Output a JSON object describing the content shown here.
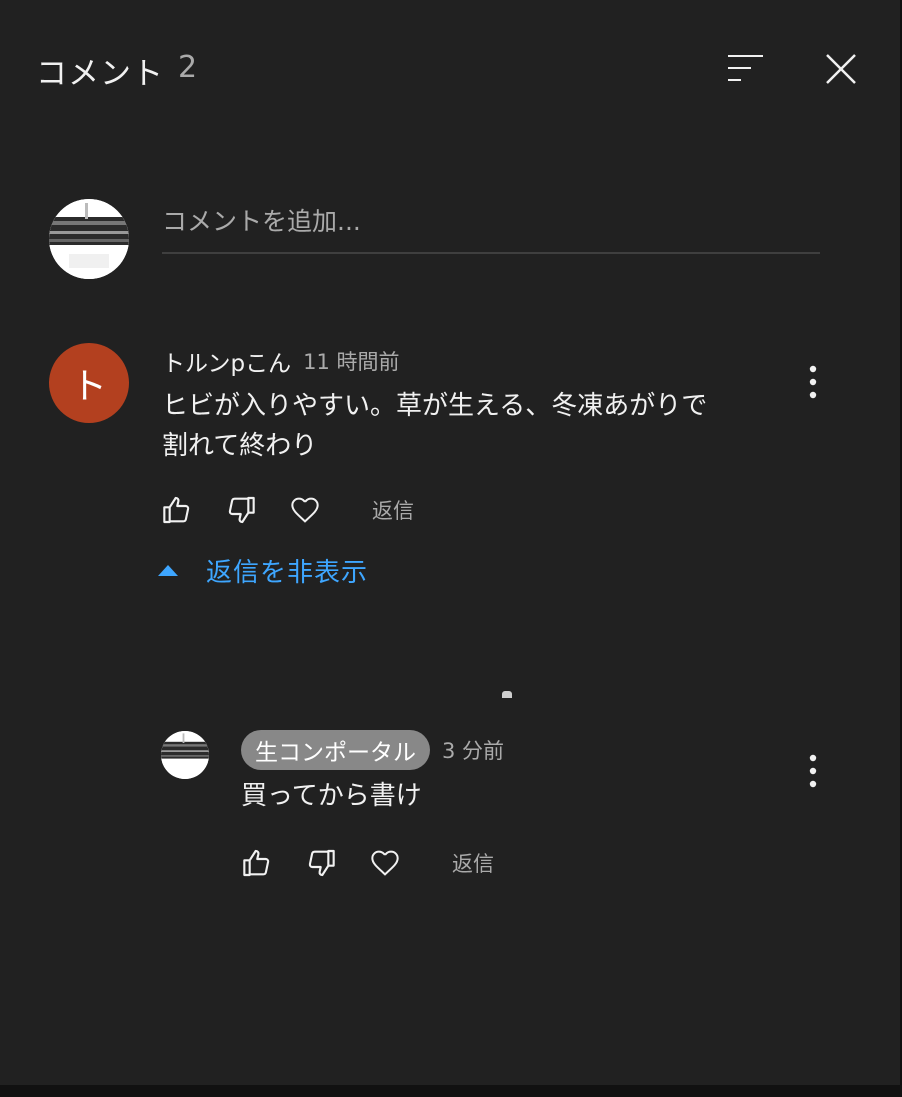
{
  "header": {
    "title": "コメント",
    "count": "2"
  },
  "add_comment": {
    "placeholder": "コメントを追加..."
  },
  "comments": [
    {
      "avatar_letter": "ト",
      "avatar_color": "#b3401f",
      "author": "トルンpこん",
      "time": "11 時間前",
      "text": "ヒビが入りやすい。草が生える、冬凍あがりで\n割れて終わり",
      "reply_label": "返信",
      "hide_replies_label": "返信を非表示"
    },
    {
      "author": "生コンポータル",
      "time": "3 分前",
      "text": "買ってから書け",
      "reply_label": "返信"
    }
  ],
  "colors": {
    "background": "#212121",
    "text_primary": "#f1f1f1",
    "text_secondary": "#aaaaaa",
    "link": "#3ea6ff",
    "author_chip": "#888888"
  },
  "icons": {
    "sort": "sort-icon",
    "close": "close-icon",
    "menu": "more-vert-icon",
    "like": "thumb-up-icon",
    "dislike": "thumb-down-icon",
    "heart": "heart-icon",
    "expand": "triangle-up-icon"
  }
}
